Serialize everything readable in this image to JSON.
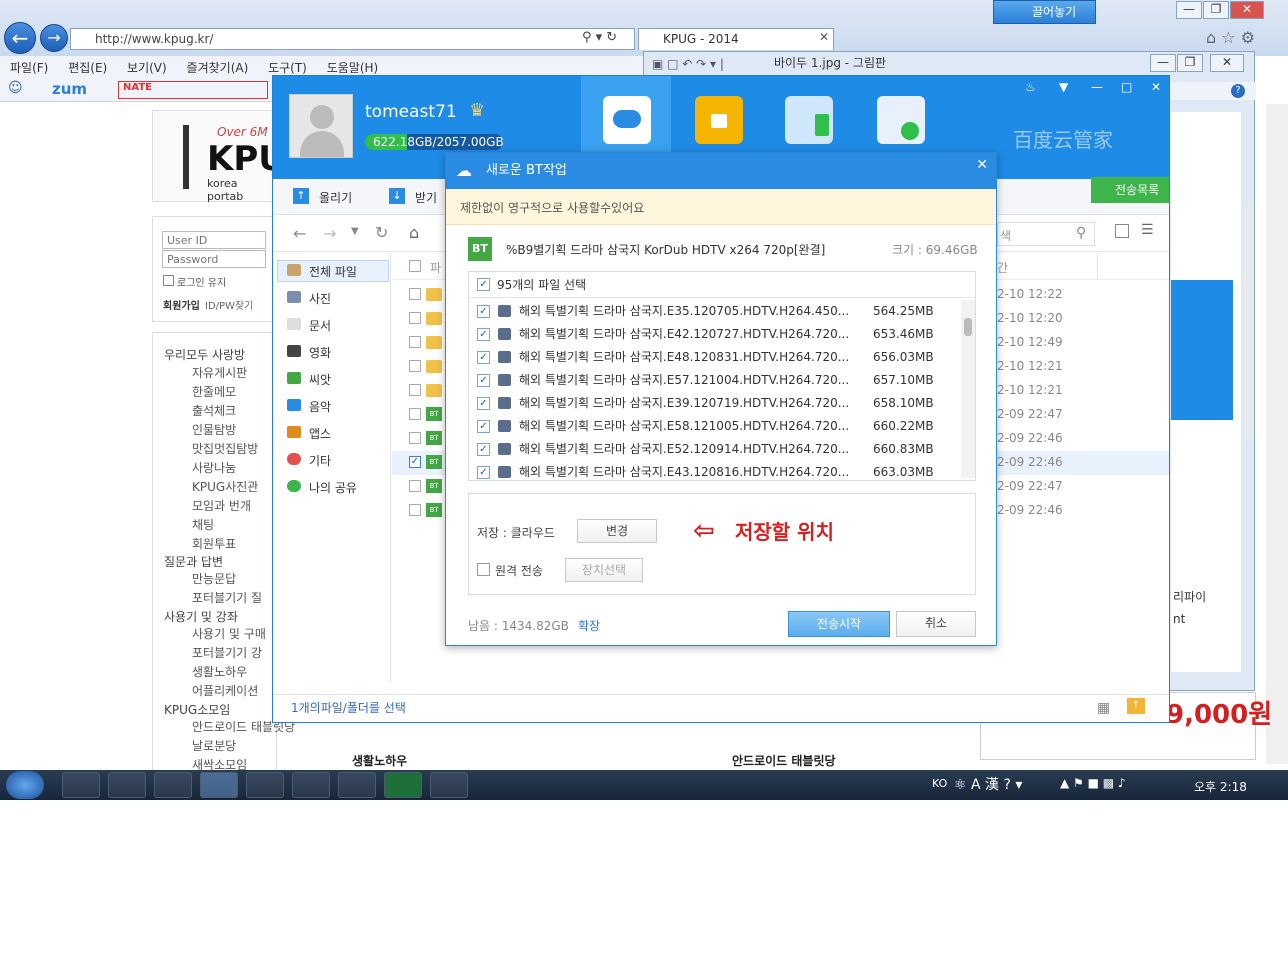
{
  "browser": {
    "url": "http://www.kpug.kr/",
    "tab_title": "KPUG - 2014",
    "menu": [
      "파일(F)",
      "편집(E)",
      "보기(V)",
      "즐겨찾기(A)",
      "도구(T)",
      "도움말(H)"
    ],
    "pin_label": "끌어놓기",
    "fav_zum": "zum",
    "fav_nate": "NATE"
  },
  "paint": {
    "title": "바이두 1.jpg - 그림판"
  },
  "site": {
    "logo_over": "Over 6M",
    "logo_text": "KPU",
    "logo_sub": "korea portab",
    "login": {
      "user_placeholder": "User ID",
      "pass_placeholder": "Password",
      "remember": "로그인 유지",
      "signup": "회원가입",
      "find": "ID/PW찾기"
    },
    "tree": [
      {
        "label": "우리모두 사랑방",
        "head": true
      },
      {
        "label": "자유게시판"
      },
      {
        "label": "한줄메모"
      },
      {
        "label": "출석체크"
      },
      {
        "label": "인물탐방"
      },
      {
        "label": "맛집멋집탐방"
      },
      {
        "label": "사랑나눔"
      },
      {
        "label": "KPUG사진관"
      },
      {
        "label": "모임과 번개"
      },
      {
        "label": "채팅"
      },
      {
        "label": "회원투표"
      },
      {
        "label": "질문과 답변",
        "head": true
      },
      {
        "label": "만능문답"
      },
      {
        "label": "포터블기기 질"
      },
      {
        "label": "사용기 및 강좌",
        "head": true
      },
      {
        "label": "사용기 및 구매"
      },
      {
        "label": "포터블기기 강"
      },
      {
        "label": "생활노하우"
      },
      {
        "label": "어플리케이션"
      },
      {
        "label": "KPUG소모임",
        "head": true
      },
      {
        "label": "안드로이드 태블릿당"
      },
      {
        "label": "날로분당"
      },
      {
        "label": "새싹소모임"
      }
    ],
    "bottom_left": "생활노하우",
    "bottom_right": "안드로이드 태블릿당",
    "price": "9,000원",
    "right_frag1": "리파이",
    "right_frag2": "nt"
  },
  "baidu": {
    "username": "tomeast71",
    "quota_text": "622.18GB/2057.00GB",
    "quota_fraction": 0.302,
    "brand": "百度云管家",
    "upload": "올리기",
    "download": "받기",
    "transfer_list": "전송목록",
    "search_placeholder": "색",
    "categories": [
      "전체 파일",
      "사진",
      "문서",
      "영화",
      "씨앗",
      "음악",
      "앱스",
      "기타",
      "나의 공유"
    ],
    "col_file": "파",
    "col_time": "간",
    "dates": [
      "2-10 12:22",
      "2-10 12:20",
      "2-10 12:49",
      "2-10 12:21",
      "2-10 12:21",
      "2-09 22:47",
      "2-09 22:46",
      "2-09 22:46",
      "2-09 22:47",
      "2-09 22:46"
    ],
    "status": "1개의파일/폴더를 선택"
  },
  "dialog": {
    "title": "새로운 BT작업",
    "notice": "제한없이 영구적으로 사용할수있어요",
    "torrent_name": "%B9별기획 드라마 삼국지 KorDub HDTV x264 720p[완결]",
    "total_size": "크기 : 69.46GB",
    "select_all": "95개의 파일 선택",
    "files": [
      {
        "name": "해외 특별기획 드라마 삼국지.E35.120705.HDTV.H264.450...",
        "size": "564.25MB"
      },
      {
        "name": "해외 특별기획 드라마 삼국지.E42.120727.HDTV.H264.720...",
        "size": "653.46MB"
      },
      {
        "name": "해외 특별기획 드라마 삼국지.E48.120831.HDTV.H264.720...",
        "size": "656.03MB"
      },
      {
        "name": "해외 특별기획 드라마 삼국지.E57.121004.HDTV.H264.720...",
        "size": "657.10MB"
      },
      {
        "name": "해외 특별기획 드라마 삼국지.E39.120719.HDTV.H264.720...",
        "size": "658.10MB"
      },
      {
        "name": "해외 특별기획 드라마 삼국지.E58.121005.HDTV.H264.720...",
        "size": "660.22MB"
      },
      {
        "name": "해외 특별기획 드라마 삼국지.E52.120914.HDTV.H264.720...",
        "size": "660.83MB"
      },
      {
        "name": "해외 특별기획 드라마 삼국지.E43.120816.HDTV.H264.720...",
        "size": "663.03MB"
      }
    ],
    "save_label": "저장 : 클라우드",
    "change_btn": "변경",
    "annotation": "저장할 위치",
    "remote_label": "원격 전송",
    "device_btn": "장치선택",
    "remaining": "남음 : 1434.82GB",
    "expand": "확장",
    "start_btn": "전송시작",
    "cancel_btn": "취소"
  },
  "taskbar": {
    "lang": "KO",
    "clock": "오후 2:18"
  }
}
